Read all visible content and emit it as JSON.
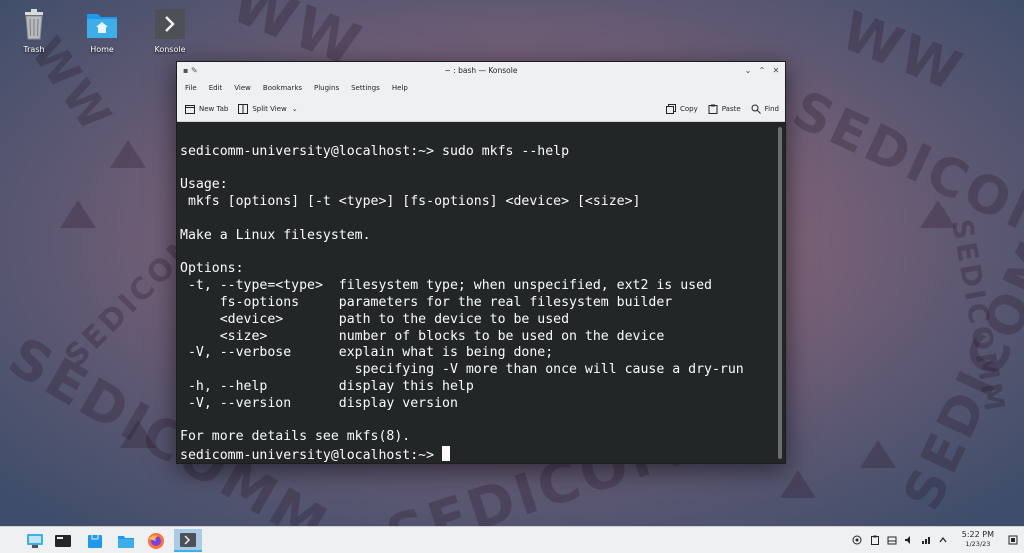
{
  "desktop": {
    "icons": [
      {
        "label": "Trash",
        "icon": "trash-icon"
      },
      {
        "label": "Home",
        "icon": "home-folder-icon"
      },
      {
        "label": "Konsole",
        "icon": "konsole-icon"
      }
    ],
    "wallpaper_text": "SEDICOMM"
  },
  "window": {
    "title": "~ : bash — Konsole",
    "menu": [
      "File",
      "Edit",
      "View",
      "Bookmarks",
      "Plugins",
      "Settings",
      "Help"
    ],
    "toolbar": {
      "new_tab": "New Tab",
      "split_view": "Split View",
      "copy": "Copy",
      "paste": "Paste",
      "find": "Find"
    }
  },
  "terminal": {
    "lines": [
      "sedicomm-university@localhost:~> sudo mkfs --help",
      "",
      "Usage:",
      " mkfs [options] [-t <type>] [fs-options] <device> [<size>]",
      "",
      "Make a Linux filesystem.",
      "",
      "Options:",
      " -t, --type=<type>  filesystem type; when unspecified, ext2 is used",
      "     fs-options     parameters for the real filesystem builder",
      "     <device>       path to the device to be used",
      "     <size>         number of blocks to be used on the device",
      " -V, --verbose      explain what is being done;",
      "                      specifying -V more than once will cause a dry-run",
      " -h, --help         display this help",
      " -V, --version      display version",
      "",
      "For more details see mkfs(8)."
    ],
    "prompt": "sedicomm-university@localhost:~> "
  },
  "taskbar": {
    "items": [
      {
        "name": "application-launcher-icon"
      },
      {
        "name": "pager-icon"
      },
      {
        "name": "discover-icon"
      },
      {
        "name": "dolphin-icon"
      },
      {
        "name": "firefox-icon"
      },
      {
        "name": "konsole-icon"
      }
    ],
    "clock": {
      "time": "5:22 PM",
      "date": "1/23/23"
    }
  },
  "colors": {
    "terminal_bg": "#232627",
    "terminal_fg": "#fcfcfc",
    "accent": "#3daee9",
    "panel": "#eff0f1"
  }
}
